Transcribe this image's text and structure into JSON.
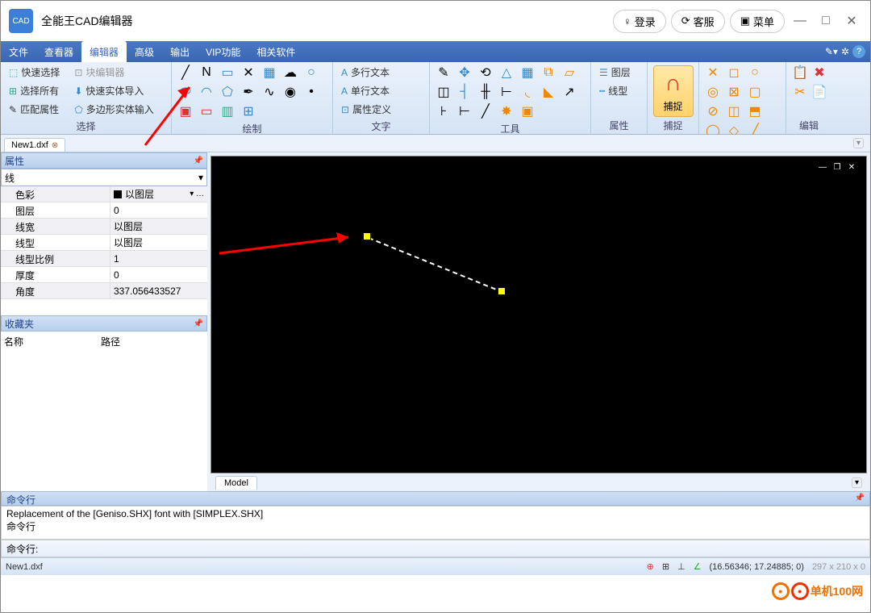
{
  "app": {
    "title": "全能王CAD编辑器",
    "icon_label": "CAD"
  },
  "title_buttons": {
    "login": "登录",
    "support": "客服",
    "menu": "菜单"
  },
  "menubar": [
    "文件",
    "查看器",
    "编辑器",
    "高级",
    "输出",
    "VIP功能",
    "相关软件"
  ],
  "menubar_active_index": 2,
  "ribbon": {
    "select": {
      "title": "选择",
      "quick_select": "快速选择",
      "select_all": "选择所有",
      "match_prop": "匹配属性",
      "block_editor": "块编辑器",
      "quick_entity_import": "快速实体导入",
      "polygon_entity_input": "多边形实体输入"
    },
    "draw": {
      "title": "绘制"
    },
    "text": {
      "title": "文字",
      "mtext": "多行文本",
      "stext": "单行文本",
      "attrdef": "属性定义"
    },
    "tools": {
      "title": "工具"
    },
    "layer": {
      "title": "属性",
      "layer": "图层",
      "linetype": "线型"
    },
    "snap": {
      "title": "捕捉",
      "big_label": "捕捉"
    },
    "edit": {
      "title": "编辑"
    }
  },
  "file_tab": "New1.dxf",
  "properties": {
    "panel_title": "属性",
    "object_type": "线",
    "rows": [
      {
        "k": "色彩",
        "v": "以图层",
        "swatch": true,
        "dropdown": true
      },
      {
        "k": "图层",
        "v": "0"
      },
      {
        "k": "线宽",
        "v": "以图层"
      },
      {
        "k": "线型",
        "v": "以图层"
      },
      {
        "k": "线型比例",
        "v": "1"
      },
      {
        "k": "厚度",
        "v": "0"
      },
      {
        "k": "角度",
        "v": "337.056433527"
      }
    ]
  },
  "favorites": {
    "title": "收藏夹",
    "col_name": "名称",
    "col_path": "路径"
  },
  "model_tab": "Model",
  "command": {
    "title": "命令行",
    "history1": "Replacement of the [Geniso.SHX] font with [SIMPLEX.SHX]",
    "history2": "命令行",
    "prompt": "命令行:"
  },
  "status": {
    "file": "New1.dxf",
    "coords": "(16.56346; 17.24885; 0)",
    "dims": "297 x 210 x 0"
  },
  "watermark": "单机100网"
}
